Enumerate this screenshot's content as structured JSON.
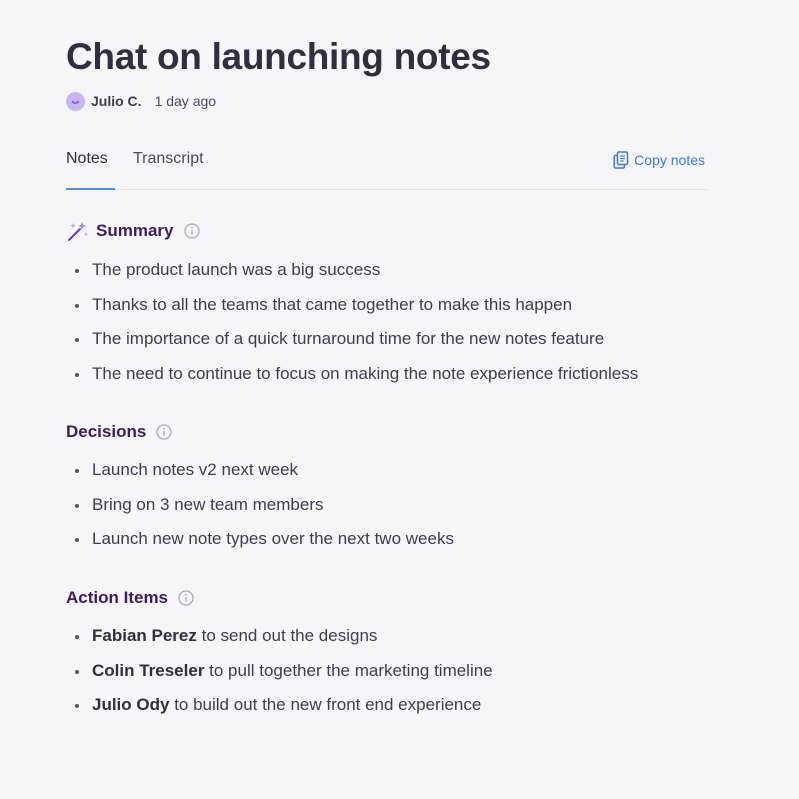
{
  "title": "Chat on launching notes",
  "meta": {
    "author": "Julio C.",
    "time": "1 day ago",
    "avatar_icon": "smiley-avatar-icon",
    "avatar_color": "#c8b6f2"
  },
  "tabs": [
    {
      "label": "Notes",
      "active": true
    },
    {
      "label": "Transcript",
      "active": false
    }
  ],
  "copy_notes": {
    "label": "Copy notes",
    "icon": "copy-icon",
    "color": "#3a7bd5"
  },
  "summary": {
    "title": "Summary",
    "icon": "magic-wand-sparkle-icon",
    "items": [
      "The product launch was a big success",
      "Thanks to all the teams that came together to make this happen",
      "The importance of a quick turnaround time for the new notes feature",
      "The need to continue to focus on making the note experience frictionless"
    ]
  },
  "decisions": {
    "title": "Decisions",
    "items": [
      "Launch notes v2 next week",
      "Bring on 3 new team members",
      "Launch new note types over the next two weeks"
    ]
  },
  "action_items": {
    "title": "Action Items",
    "items": [
      {
        "person": "Fabian Perez",
        "task": " to send out the designs"
      },
      {
        "person": "Colin Treseler",
        "task": " to pull together the marketing timeline"
      },
      {
        "person": "Julio Ody",
        "task": " to build out the new front end experience"
      }
    ]
  },
  "colors": {
    "background": "#f6f5f9",
    "section_title": "#3a1d63",
    "accent_blue": "#4d8fe0"
  }
}
